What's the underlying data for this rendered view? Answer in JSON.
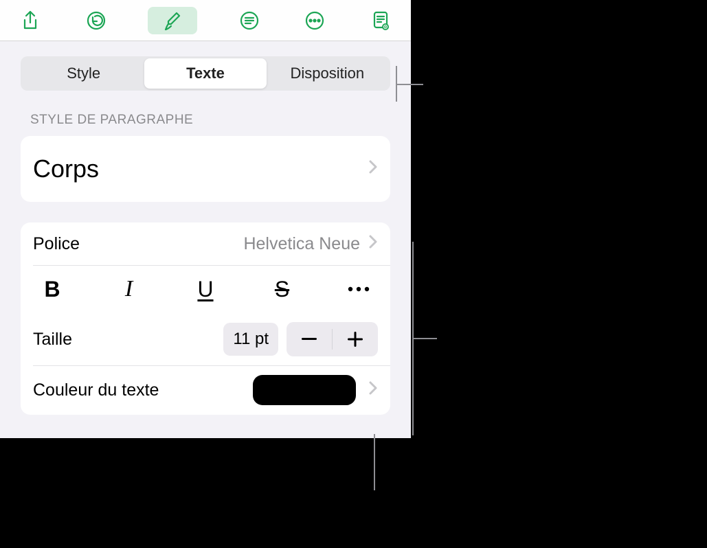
{
  "toolbar": {
    "icons": [
      "share",
      "undo",
      "format-brush",
      "comment",
      "more",
      "document-view"
    ]
  },
  "segments": {
    "style": "Style",
    "text": "Texte",
    "layout": "Disposition"
  },
  "paragraph_section_label": "STYLE DE PARAGRAPHE",
  "paragraph_style": "Corps",
  "font": {
    "label": "Police",
    "value": "Helvetica Neue"
  },
  "style_buttons": {
    "bold": "B",
    "italic": "I",
    "underline": "U",
    "strike": "S"
  },
  "size": {
    "label": "Taille",
    "value": "11 pt"
  },
  "text_color": {
    "label": "Couleur du texte",
    "value": "#000000"
  }
}
